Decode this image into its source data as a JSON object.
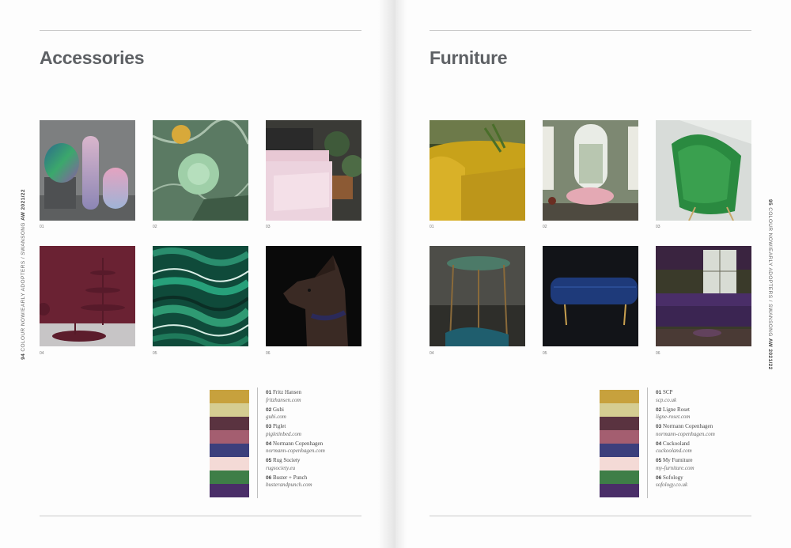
{
  "left_page": {
    "title": "Accessories",
    "spine_text": "COLOUR NOW/EARLY ADOPTERS / SWANSONG",
    "spine_bold_page": "94",
    "spine_bold_season": "AW 2021/22",
    "captions": [
      "01",
      "02",
      "03",
      "04",
      "05",
      "06"
    ],
    "swatch_colors": [
      "#c7a13d",
      "#d5cd92",
      "#5a3340",
      "#a45e70",
      "#3c3f7c",
      "#f4dad6",
      "#3e7e47",
      "#4a2e68"
    ],
    "legend": [
      {
        "num": "01",
        "name": "Fritz Hansen",
        "url": "fritzhansen.com"
      },
      {
        "num": "02",
        "name": "Gubi",
        "url": "gubi.com"
      },
      {
        "num": "03",
        "name": "Piglet",
        "url": "pigletinbed.com"
      },
      {
        "num": "04",
        "name": "Normann Copenhagen",
        "url": "normann-copenhagen.com"
      },
      {
        "num": "05",
        "name": "Rug Society",
        "url": "rugsociety.eu"
      },
      {
        "num": "06",
        "name": "Buster + Punch",
        "url": "busterandpunch.com"
      }
    ]
  },
  "right_page": {
    "title": "Furniture",
    "spine_text": "COLOUR NOW/EARLY ADOPTERS / SWANSONG",
    "spine_bold_page": "95",
    "spine_bold_season": "AW 2021/22",
    "captions": [
      "01",
      "02",
      "03",
      "04",
      "05",
      "06"
    ],
    "swatch_colors": [
      "#c7a13d",
      "#d5cd92",
      "#5a3340",
      "#a45e70",
      "#3c3f7c",
      "#f4dad6",
      "#3e7e47",
      "#4a2e68"
    ],
    "legend": [
      {
        "num": "01",
        "name": "SCP",
        "url": "scp.co.uk"
      },
      {
        "num": "02",
        "name": "Ligne Roset",
        "url": "ligne-roset.com"
      },
      {
        "num": "03",
        "name": "Normann Copenhagen",
        "url": "normann-copenhagen.com"
      },
      {
        "num": "04",
        "name": "Cuckooland",
        "url": "cuckooland.com"
      },
      {
        "num": "05",
        "name": "My Furniture",
        "url": "my-furniture.com"
      },
      {
        "num": "06",
        "name": "Sofology",
        "url": "sofology.co.uk"
      }
    ]
  }
}
